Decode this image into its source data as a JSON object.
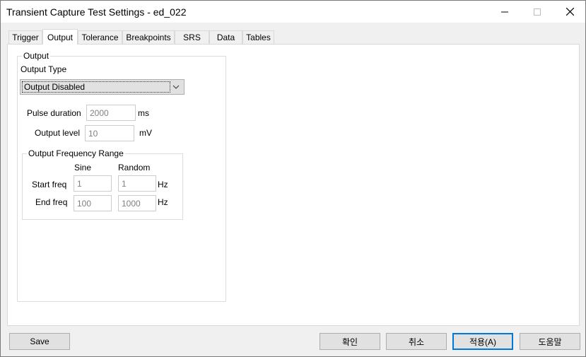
{
  "window": {
    "title": "Transient Capture Test Settings - ed_022"
  },
  "tabs": [
    {
      "label": "Trigger",
      "active": false
    },
    {
      "label": "Output",
      "active": true
    },
    {
      "label": "Tolerance",
      "active": false
    },
    {
      "label": "Breakpoints",
      "active": false
    },
    {
      "label": "SRS",
      "active": false
    },
    {
      "label": "Data",
      "active": false
    },
    {
      "label": "Tables",
      "active": false
    }
  ],
  "output_group": {
    "legend": "Output",
    "output_type_label": "Output Type",
    "output_type_value": "Output Disabled",
    "pulse_duration_label": "Pulse duration",
    "pulse_duration_value": "2000",
    "pulse_duration_unit": "ms",
    "output_level_label": "Output level",
    "output_level_value": "10",
    "output_level_unit": "mV"
  },
  "freq_range": {
    "legend": "Output Frequency Range",
    "col_sine": "Sine",
    "col_random": "Random",
    "start_label": "Start freq",
    "start_sine": "1",
    "start_random": "1",
    "start_unit": "Hz",
    "end_label": "End freq",
    "end_sine": "100",
    "end_random": "1000",
    "end_unit": "Hz"
  },
  "buttons": {
    "save": "Save",
    "ok": "확인",
    "cancel": "취소",
    "apply": "적용(A)",
    "help": "도움말"
  },
  "colors": {
    "default_button_border": "#0078d7",
    "disabled_text": "#808080"
  }
}
